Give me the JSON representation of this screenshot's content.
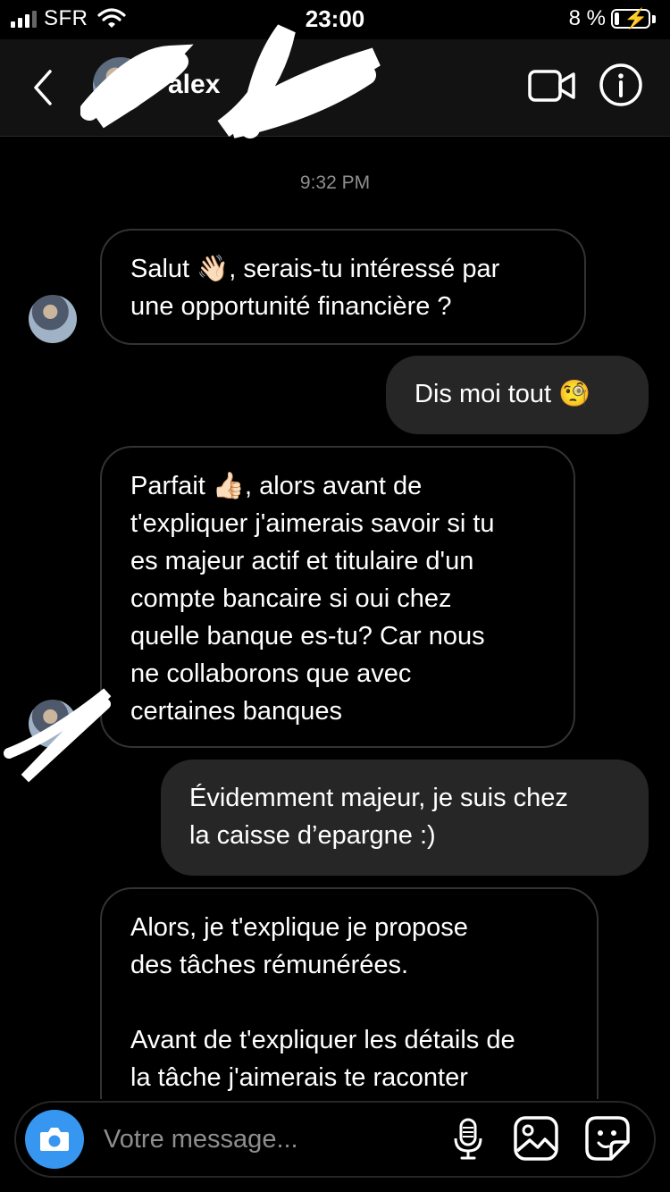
{
  "status_bar": {
    "carrier": "SFR",
    "time": "23:00",
    "battery_percent": "8 %"
  },
  "header": {
    "contact_name": "alex"
  },
  "chat": {
    "timestamp": "9:32 PM",
    "messages": [
      {
        "direction": "incoming",
        "text": "Salut 👋🏻, serais-tu intéressé par\nune opportunité financière ?"
      },
      {
        "direction": "outgoing",
        "text": "Dis moi tout 🧐"
      },
      {
        "direction": "incoming",
        "text": "Parfait 👍🏻, alors avant de\nt'expliquer j'aimerais savoir si tu\nes majeur actif et titulaire d'un\ncompte bancaire si oui chez\nquelle banque es-tu? Car nous\nne collaborons que avec\ncertaines banques"
      },
      {
        "direction": "outgoing",
        "text": "Évidemment majeur, je suis chez\nla caisse d’epargne :)"
      },
      {
        "direction": "incoming",
        "text": "Alors, je t'explique je propose\ndes tâches rémunérées.\n\nAvant de t'expliquer les détails de\nla tâche j'aimerais te raconter"
      }
    ]
  },
  "composer": {
    "placeholder": "Votre message..."
  },
  "colors": {
    "accent": "#3797f0",
    "background": "#000000",
    "outgoing_bubble": "#262626",
    "secondary_text": "#8e8e8e"
  }
}
